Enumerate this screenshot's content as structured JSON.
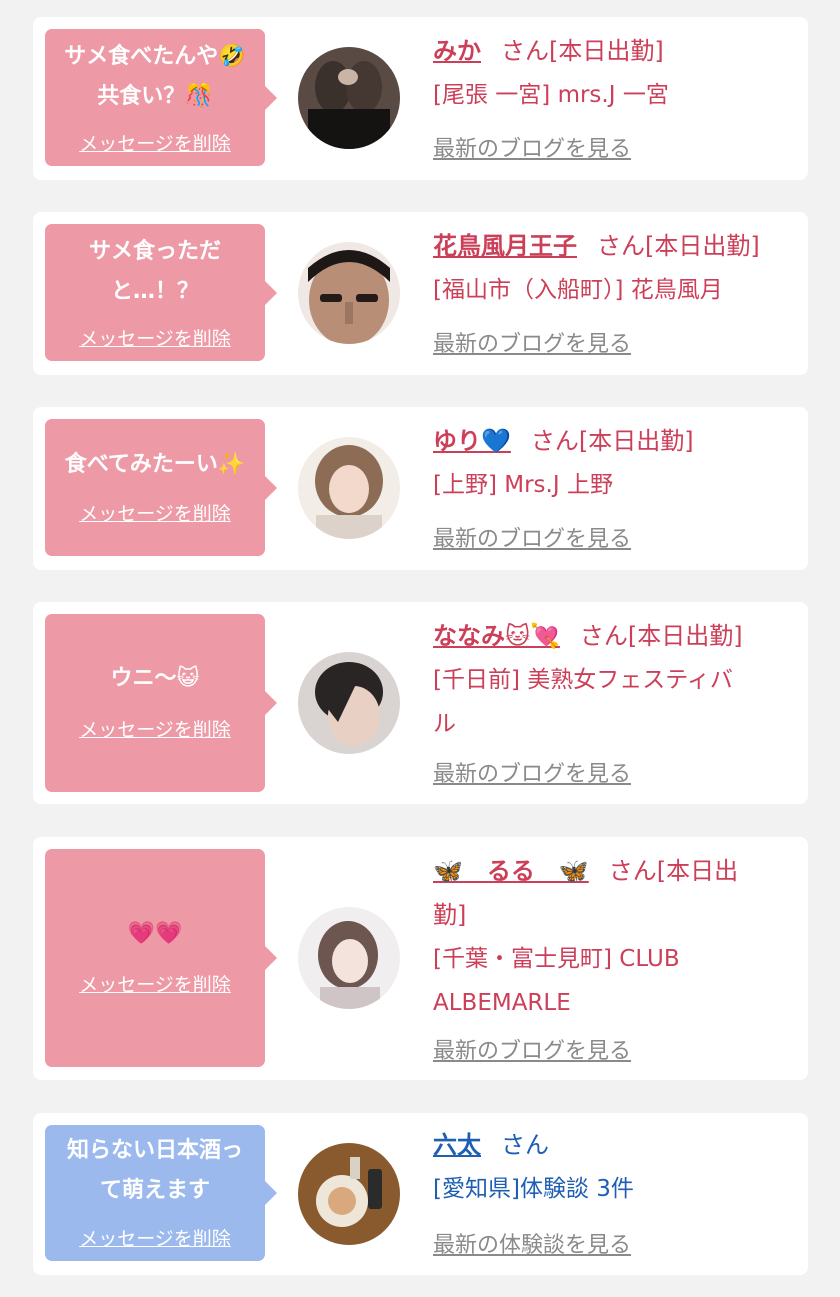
{
  "cards": [
    {
      "message_line1": "サメ食べたんや🤣",
      "message_line2": "共食い？🎊",
      "delete_label": "メッセージを削除",
      "name": "みか",
      "suffix": "さん[本日出勤]",
      "shop": "[尾張 一宮] mrs.J 一宮",
      "blog_label": "最新のブログを見る"
    },
    {
      "message_line1": "サメ食っただ",
      "message_line2": "と…！？",
      "delete_label": "メッセージを削除",
      "name": "花鳥風月王子",
      "suffix": "さん[本日出勤]",
      "shop": "[福山市（入船町）] 花鳥風月",
      "blog_label": "最新のブログを見る"
    },
    {
      "message_line1": "食べてみたーい✨",
      "delete_label": "メッセージを削除",
      "name": "ゆり💙",
      "suffix": "さん[本日出勤]",
      "shop": "[上野] Mrs.J 上野",
      "blog_label": "最新のブログを見る"
    },
    {
      "message_line1": "ウニ〜😺",
      "delete_label": "メッセージを削除",
      "name": "ななみ🐱💘",
      "suffix": "さん[本日出勤]",
      "shop_line1": "[千日前] 美熟女フェスティバ",
      "shop_line2": "ル",
      "blog_label": "最新のブログを見る"
    },
    {
      "message_line1": "💗💗",
      "delete_label": "メッセージを削除",
      "name": "🦋　るる　🦋",
      "suffix": "さん[本日出",
      "suffix_line2": "勤]",
      "shop_line1": "[千葉・富士見町] CLUB",
      "shop_line2": "ALBEMARLE",
      "blog_label": "最新のブログを見る"
    },
    {
      "message_line1": "知らない日本酒っ",
      "message_line2": "て萌えます",
      "delete_label": "メッセージを削除",
      "name": "六太",
      "suffix": "さん",
      "shop": "[愛知県]体験談 3件",
      "blog_label": "最新の体験談を見る"
    }
  ],
  "colors": {
    "page_bg": "#f2f2f2",
    "bubble_pink": "#ee9aa6",
    "bubble_blue": "#9cb9ee",
    "name_pink": "#cc3f59",
    "name_blue": "#1f5fb3",
    "link_gray": "#8a8a8a"
  }
}
